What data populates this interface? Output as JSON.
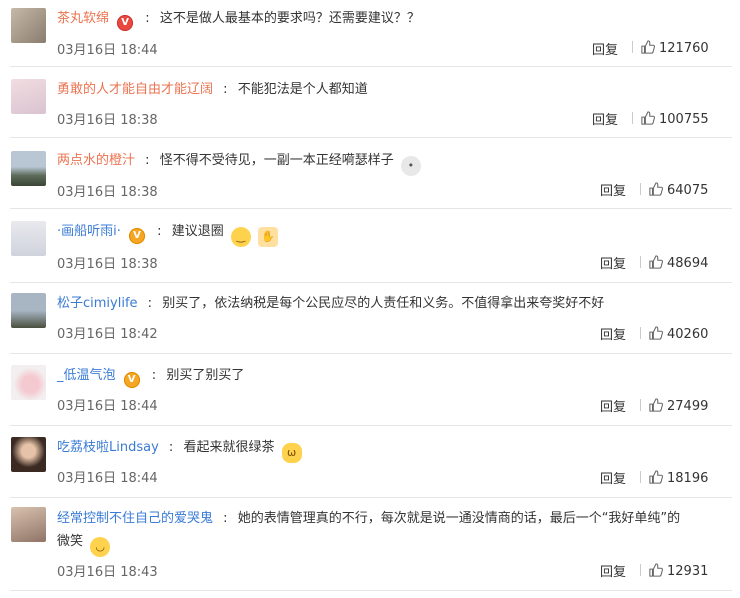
{
  "comments": [
    {
      "user": "茶丸软绵",
      "badge": "red",
      "text": "这不是做人最基本的要求吗？还需要建议？？",
      "time": "03月16日 18:44",
      "reply": "回复",
      "likes": "121760",
      "emoji": ""
    },
    {
      "user": "勇敢的人才能自由才能辽阔",
      "badge": "",
      "text": "不能犯法是个人都知道",
      "time": "03月16日 18:38",
      "reply": "回复",
      "likes": "100755",
      "emoji": ""
    },
    {
      "user": "两点水的橙汁",
      "badge": "",
      "text": "怪不得不受待见，一副一本正经嗬瑟样子",
      "time": "03月16日 18:38",
      "reply": "回复",
      "likes": "64075",
      "emoji": "doge"
    },
    {
      "user": "·画船听雨i·",
      "badge": "gold",
      "text": "建议退圈",
      "time": "03月16日 18:38",
      "reply": "回复",
      "likes": "48694",
      "emoji": "meh"
    },
    {
      "user": "松子cimiylife",
      "badge": "",
      "text": "别买了，依法纳税是每个公民应尽的人责任和义务。不值得拿出来夸奖好不好",
      "time": "03月16日 18:42",
      "reply": "回复",
      "likes": "40260",
      "emoji": ""
    },
    {
      "user": "_低温气泡",
      "badge": "gold",
      "text": "别买了别买了",
      "time": "03月16日 18:44",
      "reply": "回复",
      "likes": "27499",
      "emoji": ""
    },
    {
      "user": "吃荔枝啦Lindsay",
      "badge": "",
      "text": "看起来就很绿茶",
      "time": "03月16日 18:44",
      "reply": "回复",
      "likes": "18196",
      "emoji": "cat"
    },
    {
      "user": "经常控制不住自己的爱哭鬼",
      "badge": "",
      "text": "她的表情管理真的不行，每次就是说一通没情商的话，最后一个“我好单纯”的",
      "text2": "微笑",
      "time": "03月16日 18:43",
      "reply": "回复",
      "likes": "12931",
      "emoji": "smile"
    }
  ],
  "badges": {
    "v_label": "V"
  },
  "colors": {
    "username": "#eb7350",
    "time": "#666666",
    "divider": "#e6e6e6",
    "badge_gold": "#f5a623",
    "badge_red": "#e8483e"
  }
}
